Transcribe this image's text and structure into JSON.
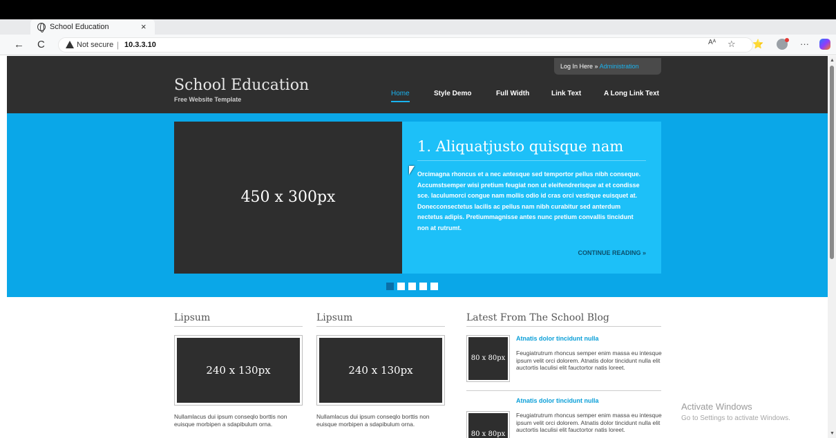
{
  "browser": {
    "tab_title": "School Education",
    "tab_close": "×",
    "new_tab": "+",
    "security_label": "Not secure",
    "url_separator": "|",
    "url": "10.3.3.10",
    "window_controls": [
      "–",
      "▢",
      "✕"
    ],
    "nav": {
      "back": "←",
      "reload": "C"
    },
    "right_icons": [
      "Aᴬ",
      "☆",
      "⭐",
      "···"
    ]
  },
  "site": {
    "login_prefix": "Log In Here »",
    "login_link": "Administration",
    "logo": "School Education",
    "tagline": "Free Website Template",
    "nav": [
      "Home",
      "Style Demo",
      "Full Width",
      "Link Text",
      "A Long Link Text"
    ],
    "slide": {
      "image_label": "450 x 300px",
      "title": "1. Aliquatjusto quisque nam",
      "body": "Orcimagna rhoncus et a nec antesque sed temportor pellus nibh conseque. Accumstsemper wisi pretium feugiat non ut eleifendrerisque at et condisse sce. Iaculumorci congue nam mollis odio id cras orci vestique euisquet at. Donecconsectetus lacilis ac pellus nam nibh curabitur sed anterdum nectetus adipis. Pretiummagnisse antes nunc pretium convallis tincidunt non at rutrumt.",
      "continue": "CONTINUE READING »",
      "active_dot": 1,
      "dot_count": 5
    },
    "columns": [
      {
        "title": "Lipsum",
        "image_label": "240 x 130px",
        "text": "Nullamlacus dui ipsum conseqlo borttis non euisque morbipen a sdapibulum orna."
      },
      {
        "title": "Lipsum",
        "image_label": "240 x 130px",
        "text": "Nullamlacus dui ipsum conseqlo borttis non euisque morbipen a sdapibulum orna."
      }
    ],
    "blog": {
      "title": "Latest From The School Blog",
      "posts": [
        {
          "thumb": "80 x 80px",
          "title": "Atnatis dolor tincidunt nulla",
          "text": "Feugiatrutrum rhoncus semper enim massa eu intesque ipsum velit orci dolorem. Atnatis dolor tincidunt nulla elit auctortis laculisi elit fauctortor natis loreet."
        },
        {
          "thumb": "80 x 80px",
          "title": "Atnatis dolor tincidunt nulla",
          "text": "Feugiatrutrum rhoncus semper enim massa eu intesque ipsum velit orci dolorem. Atnatis dolor tincidunt nulla elit auctortis laculisi elit fauctortor natis loreet."
        }
      ]
    }
  },
  "os_overlay": {
    "activate_title": "Activate Windows",
    "activate_sub": "Go to Settings to activate Windows."
  },
  "colors": {
    "header_bg": "#2f2f2f",
    "hero_bg": "#0aa7e8",
    "slide_text_bg": "#1dc0f8",
    "accent": "#1ab4f0"
  }
}
